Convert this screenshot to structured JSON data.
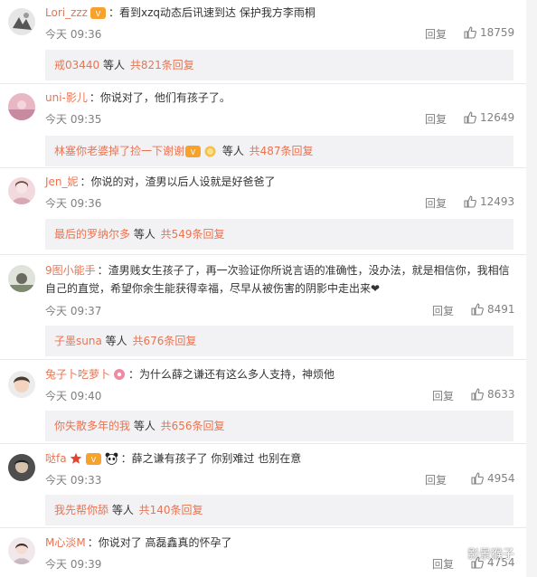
{
  "comments": [
    {
      "name": "Lori_zzz",
      "text": "：看到xzq动态后讯速到达 保护我方李雨桐",
      "text_cont": "",
      "time": "今天 09:36",
      "reply_label": "回复",
      "likes": "18759",
      "sub_reply": {
        "names": "戒03440",
        "mid": " 等人 ",
        "count": "共821条回复"
      }
    },
    {
      "name": "uni-影儿",
      "text": "：你说对了，他们有孩子了。",
      "text_cont": "",
      "time": "今天 09:35",
      "reply_label": "回复",
      "likes": "12649",
      "sub_reply": {
        "names": "林塞你老婆掉了捡一下谢谢",
        "mid": " 等人 ",
        "count": "共487条回复"
      }
    },
    {
      "name": "Jen_妮",
      "text": "：你说的对，渣男以后人设就是好爸爸了",
      "text_cont": "",
      "time": "今天 09:36",
      "reply_label": "回复",
      "likes": "12493",
      "sub_reply": {
        "names": "最后的罗纳尔多",
        "mid": " 等人 ",
        "count": "共549条回复"
      }
    },
    {
      "name": "9图小能手",
      "text": "：渣男贱女生孩子了，再一次验证你所说言语的准确性，没办法，就是相信你，我相信",
      "text_cont": "自己的直觉，希望你余生能获得幸福，尽早从被伤害的阴影中走出来❤",
      "time": "今天 09:37",
      "reply_label": "回复",
      "likes": "8491",
      "sub_reply": {
        "names": "子墨suna",
        "mid": " 等人 ",
        "count": "共676条回复"
      }
    },
    {
      "name": "兔子卜吃萝卜",
      "text": "：为什么薛之谦还有这么多人支持，神烦他",
      "text_cont": "",
      "time": "今天 09:40",
      "reply_label": "回复",
      "likes": "8633",
      "sub_reply": {
        "names": "你失散多年的我",
        "mid": " 等人 ",
        "count": "共656条回复"
      }
    },
    {
      "name": "哒fa",
      "text": "：薛之谦有孩子了 你别难过 也别在意",
      "text_cont": "",
      "time": "今天 09:33",
      "reply_label": "回复",
      "likes": "4954",
      "sub_reply": {
        "names": "我先帮你舔",
        "mid": " 等人 ",
        "count": "共140条回复"
      }
    },
    {
      "name": "M心淡M",
      "text": "：你说对了 高磊鑫真的怀孕了",
      "text_cont": "",
      "time": "今天 09:39",
      "reply_label": "回复",
      "likes": "4754",
      "sub_reply": null
    }
  ],
  "watermark": {
    "text": "影景猴子"
  },
  "colors": {
    "name": "#eb7350",
    "meta": "#808080",
    "sub_bg": "#f2f2f5"
  }
}
